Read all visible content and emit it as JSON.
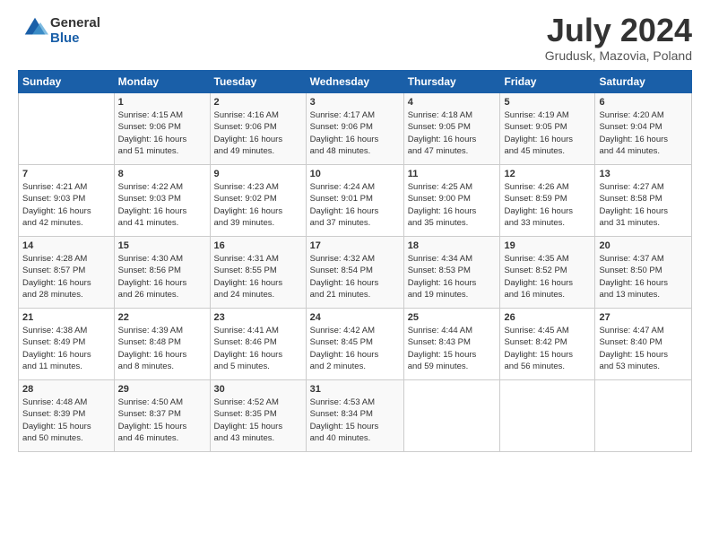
{
  "logo": {
    "general": "General",
    "blue": "Blue"
  },
  "header": {
    "month": "July 2024",
    "location": "Grudusk, Mazovia, Poland"
  },
  "days_of_week": [
    "Sunday",
    "Monday",
    "Tuesday",
    "Wednesday",
    "Thursday",
    "Friday",
    "Saturday"
  ],
  "weeks": [
    [
      {
        "day": "",
        "info": ""
      },
      {
        "day": "1",
        "info": "Sunrise: 4:15 AM\nSunset: 9:06 PM\nDaylight: 16 hours\nand 51 minutes."
      },
      {
        "day": "2",
        "info": "Sunrise: 4:16 AM\nSunset: 9:06 PM\nDaylight: 16 hours\nand 49 minutes."
      },
      {
        "day": "3",
        "info": "Sunrise: 4:17 AM\nSunset: 9:06 PM\nDaylight: 16 hours\nand 48 minutes."
      },
      {
        "day": "4",
        "info": "Sunrise: 4:18 AM\nSunset: 9:05 PM\nDaylight: 16 hours\nand 47 minutes."
      },
      {
        "day": "5",
        "info": "Sunrise: 4:19 AM\nSunset: 9:05 PM\nDaylight: 16 hours\nand 45 minutes."
      },
      {
        "day": "6",
        "info": "Sunrise: 4:20 AM\nSunset: 9:04 PM\nDaylight: 16 hours\nand 44 minutes."
      }
    ],
    [
      {
        "day": "7",
        "info": "Sunrise: 4:21 AM\nSunset: 9:03 PM\nDaylight: 16 hours\nand 42 minutes."
      },
      {
        "day": "8",
        "info": "Sunrise: 4:22 AM\nSunset: 9:03 PM\nDaylight: 16 hours\nand 41 minutes."
      },
      {
        "day": "9",
        "info": "Sunrise: 4:23 AM\nSunset: 9:02 PM\nDaylight: 16 hours\nand 39 minutes."
      },
      {
        "day": "10",
        "info": "Sunrise: 4:24 AM\nSunset: 9:01 PM\nDaylight: 16 hours\nand 37 minutes."
      },
      {
        "day": "11",
        "info": "Sunrise: 4:25 AM\nSunset: 9:00 PM\nDaylight: 16 hours\nand 35 minutes."
      },
      {
        "day": "12",
        "info": "Sunrise: 4:26 AM\nSunset: 8:59 PM\nDaylight: 16 hours\nand 33 minutes."
      },
      {
        "day": "13",
        "info": "Sunrise: 4:27 AM\nSunset: 8:58 PM\nDaylight: 16 hours\nand 31 minutes."
      }
    ],
    [
      {
        "day": "14",
        "info": "Sunrise: 4:28 AM\nSunset: 8:57 PM\nDaylight: 16 hours\nand 28 minutes."
      },
      {
        "day": "15",
        "info": "Sunrise: 4:30 AM\nSunset: 8:56 PM\nDaylight: 16 hours\nand 26 minutes."
      },
      {
        "day": "16",
        "info": "Sunrise: 4:31 AM\nSunset: 8:55 PM\nDaylight: 16 hours\nand 24 minutes."
      },
      {
        "day": "17",
        "info": "Sunrise: 4:32 AM\nSunset: 8:54 PM\nDaylight: 16 hours\nand 21 minutes."
      },
      {
        "day": "18",
        "info": "Sunrise: 4:34 AM\nSunset: 8:53 PM\nDaylight: 16 hours\nand 19 minutes."
      },
      {
        "day": "19",
        "info": "Sunrise: 4:35 AM\nSunset: 8:52 PM\nDaylight: 16 hours\nand 16 minutes."
      },
      {
        "day": "20",
        "info": "Sunrise: 4:37 AM\nSunset: 8:50 PM\nDaylight: 16 hours\nand 13 minutes."
      }
    ],
    [
      {
        "day": "21",
        "info": "Sunrise: 4:38 AM\nSunset: 8:49 PM\nDaylight: 16 hours\nand 11 minutes."
      },
      {
        "day": "22",
        "info": "Sunrise: 4:39 AM\nSunset: 8:48 PM\nDaylight: 16 hours\nand 8 minutes."
      },
      {
        "day": "23",
        "info": "Sunrise: 4:41 AM\nSunset: 8:46 PM\nDaylight: 16 hours\nand 5 minutes."
      },
      {
        "day": "24",
        "info": "Sunrise: 4:42 AM\nSunset: 8:45 PM\nDaylight: 16 hours\nand 2 minutes."
      },
      {
        "day": "25",
        "info": "Sunrise: 4:44 AM\nSunset: 8:43 PM\nDaylight: 15 hours\nand 59 minutes."
      },
      {
        "day": "26",
        "info": "Sunrise: 4:45 AM\nSunset: 8:42 PM\nDaylight: 15 hours\nand 56 minutes."
      },
      {
        "day": "27",
        "info": "Sunrise: 4:47 AM\nSunset: 8:40 PM\nDaylight: 15 hours\nand 53 minutes."
      }
    ],
    [
      {
        "day": "28",
        "info": "Sunrise: 4:48 AM\nSunset: 8:39 PM\nDaylight: 15 hours\nand 50 minutes."
      },
      {
        "day": "29",
        "info": "Sunrise: 4:50 AM\nSunset: 8:37 PM\nDaylight: 15 hours\nand 46 minutes."
      },
      {
        "day": "30",
        "info": "Sunrise: 4:52 AM\nSunset: 8:35 PM\nDaylight: 15 hours\nand 43 minutes."
      },
      {
        "day": "31",
        "info": "Sunrise: 4:53 AM\nSunset: 8:34 PM\nDaylight: 15 hours\nand 40 minutes."
      },
      {
        "day": "",
        "info": ""
      },
      {
        "day": "",
        "info": ""
      },
      {
        "day": "",
        "info": ""
      }
    ]
  ]
}
